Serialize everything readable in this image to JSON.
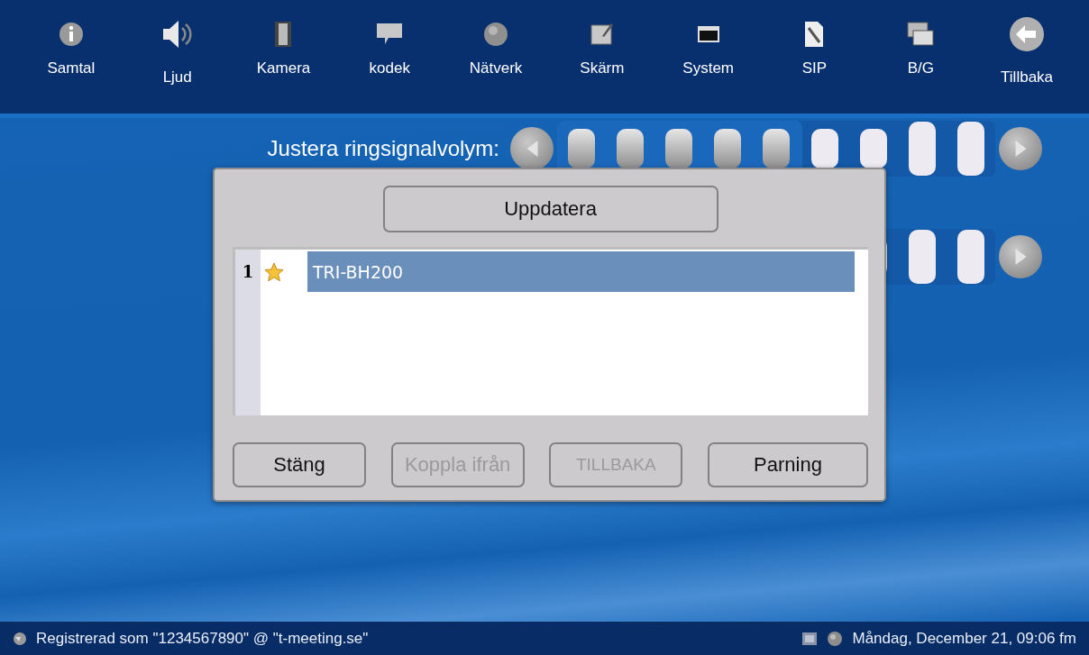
{
  "nav": [
    {
      "label": "Samtal"
    },
    {
      "label": "Ljud"
    },
    {
      "label": "Kamera"
    },
    {
      "label": "kodek"
    },
    {
      "label": "Nätverk"
    },
    {
      "label": "Skärm"
    },
    {
      "label": "System"
    },
    {
      "label": "SIP"
    },
    {
      "label": "B/G"
    },
    {
      "label": "Tillbaka"
    }
  ],
  "sliders": [
    {
      "label": "Justera ringsignalvolym:",
      "level": 0.56
    }
  ],
  "dialog": {
    "update_button": "Uppdatera",
    "devices": [
      {
        "number": "1",
        "favorite": true,
        "name": "TRI-BH200",
        "selected": true
      }
    ],
    "buttons": [
      {
        "label": "Stäng",
        "disabled": false
      },
      {
        "label": "Koppla ifrån",
        "disabled": true
      },
      {
        "label": "TILLBAKA",
        "disabled": true
      },
      {
        "label": "Parning",
        "disabled": false
      }
    ]
  },
  "status_bar": {
    "registration": "Registrerad som \"1234567890\" @ \"t-meeting.se\"",
    "datetime": "Måndag, December 21, 09:06 fm"
  }
}
